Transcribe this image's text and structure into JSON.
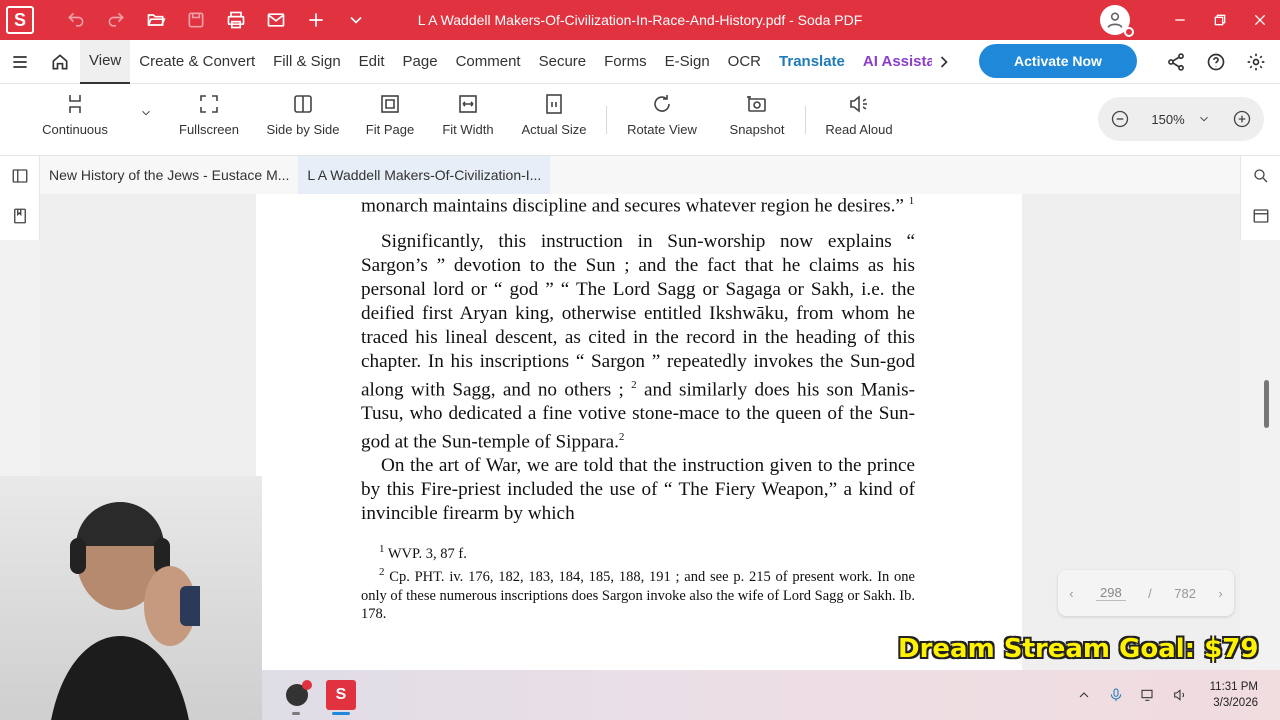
{
  "app": {
    "logo_letter": "S",
    "window_title": "L A Waddell Makers-Of-Civilization-In-Race-And-History.pdf  -  Soda PDF"
  },
  "menu": {
    "items": [
      "View",
      "Create & Convert",
      "Fill & Sign",
      "Edit",
      "Page",
      "Comment",
      "Secure",
      "Forms",
      "E-Sign",
      "OCR"
    ],
    "translate": "Translate",
    "ai": "AI Assista",
    "activate": "Activate Now"
  },
  "toolbar": {
    "continuous": "Continuous",
    "fullscreen": "Fullscreen",
    "side_by_side": "Side by Side",
    "fit_page": "Fit Page",
    "fit_width": "Fit Width",
    "actual_size": "Actual Size",
    "rotate_view": "Rotate View",
    "snapshot": "Snapshot",
    "read_aloud": "Read Aloud",
    "zoom": "150%"
  },
  "tabs": [
    "New History of the Jews - Eustace M...",
    "L A Waddell Makers-Of-Civilization-I..."
  ],
  "document": {
    "line_top": "monarch maintains discipline and secures whatever region he desires.”",
    "line_top_note": "1",
    "para1": "Significantly, this instruction in Sun-worship now explains “ Sargon’s ” devotion to the Sun ;  and the fact that he claims as his personal lord or “ god ” “ The Lord Sagg or Sagaga or Sakh, i.e. the deified first Aryan king, otherwise entitled Ikshwāku, from whom he traced his lineal descent, as cited in the record in the heading of this chapter.  In his inscriptions “ Sargon ” repeatedly invokes the Sun-god along with Sagg, and no others ;",
    "para1_note": "2",
    "para1_cont": "and similarly does his son Manis-Tusu, who dedicated a fine votive stone-mace to the queen of the Sun-god at the Sun-temple of Sippara.",
    "para1_cont_note": "2",
    "para2": "On the art of War, we are told that the instruction given to the prince by this Fire-priest included the use of “ The Fiery Weapon,” a kind of invincible firearm by which",
    "fn1_mark": "1",
    "fn1": "WVP. 3, 87 f.",
    "fn2_mark": "2",
    "fn2": "Cp. PHT. iv. 176, 182, 183, 184, 185, 188, 191 ;  and see p. 215 of present work.  In one only of these numerous inscriptions does Sargon invoke also the wife of Lord Sagg or Sakh.  Ib. 178."
  },
  "pager": {
    "current": "298",
    "separator": "/",
    "total": "782"
  },
  "overlay": {
    "goal": "Dream Stream Goal: $79"
  },
  "taskbar": {
    "time": "11:31 PM",
    "date": "3/3/2026"
  },
  "colors": {
    "brand": "#e0323f",
    "activate": "#1f88d9",
    "translate": "#1f7ab8",
    "ai": "#8b3fc9",
    "goal": "#fff200"
  }
}
